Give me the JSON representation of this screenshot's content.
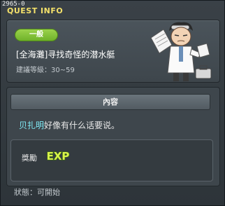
{
  "window": {
    "quest_id": "2965-0",
    "title": "QUEST INFO"
  },
  "quest": {
    "category": "一般",
    "name": "[全海灘]寻找奇怪的潜水艇",
    "level": "建議等級：30~59"
  },
  "content": {
    "header": "內容",
    "npc_name": "贝扎明",
    "description_rest": "好像有什么话要说。",
    "reward_label": "獎勵",
    "reward_icon": "exp-icon",
    "reward_icon_text": "EXP"
  },
  "status": "狀態：可開始",
  "colors": {
    "title": "#f3e06a",
    "badge": "#7cbd2f",
    "npc_name": "#7fe9f5",
    "exp": "#d8f24a"
  }
}
